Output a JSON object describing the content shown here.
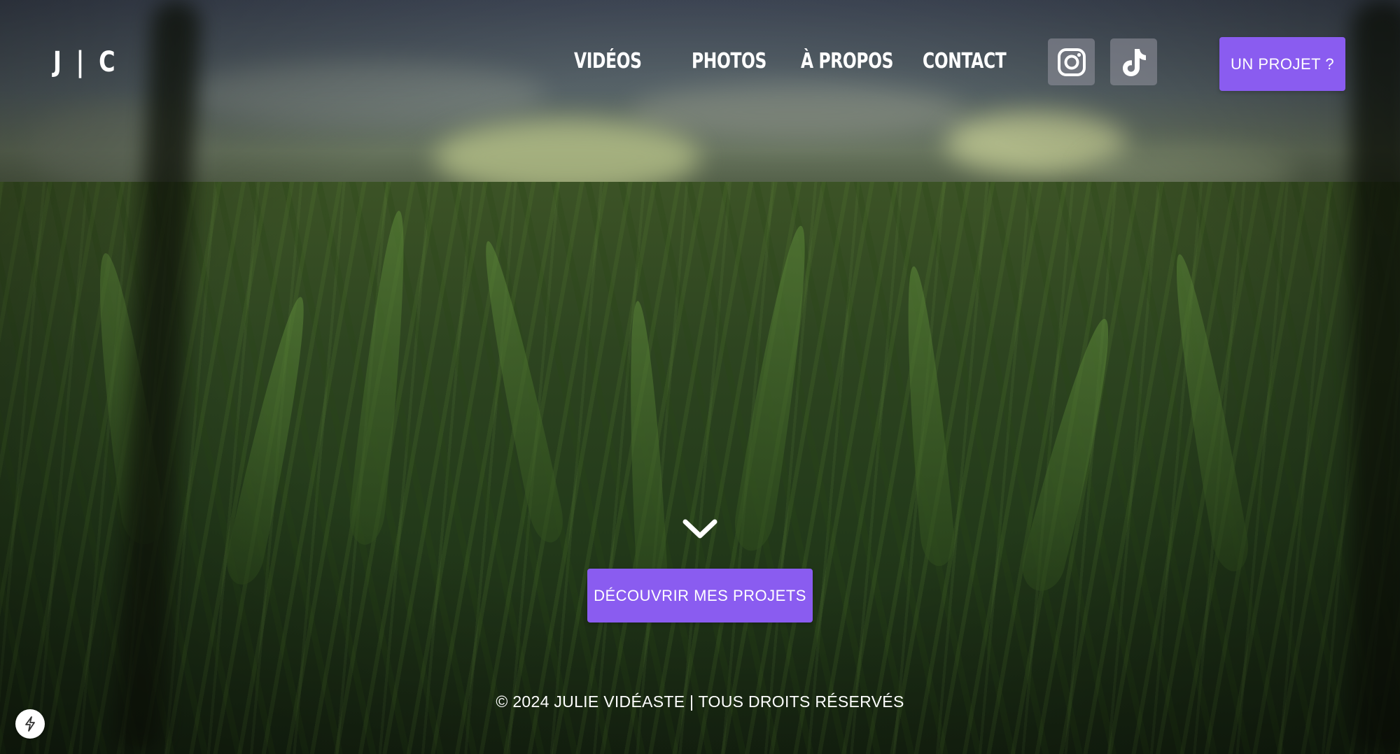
{
  "brand": {
    "logo_text": "J | C"
  },
  "nav": {
    "items": [
      {
        "label": "VIDÉOS"
      },
      {
        "label": "PHOTOS"
      },
      {
        "label": "À PROPOS"
      },
      {
        "label": "CONTACT"
      }
    ]
  },
  "social": {
    "instagram_icon": "instagram-icon",
    "tiktok_icon": "tiktok-icon"
  },
  "header": {
    "cta_label": "UN PROJET ?"
  },
  "hero": {
    "scroll_icon": "chevron-down-icon",
    "discover_label": "DÉCOUVRIR MES PROJETS"
  },
  "footer": {
    "copyright": "© 2024 JULIE VIDÉASTE | TOUS DROITS RÉSERVÉS"
  },
  "widget": {
    "icon": "lightning-icon"
  },
  "colors": {
    "accent": "#8a5cf0",
    "text": "#ffffff",
    "social_bg": "#96969f"
  }
}
